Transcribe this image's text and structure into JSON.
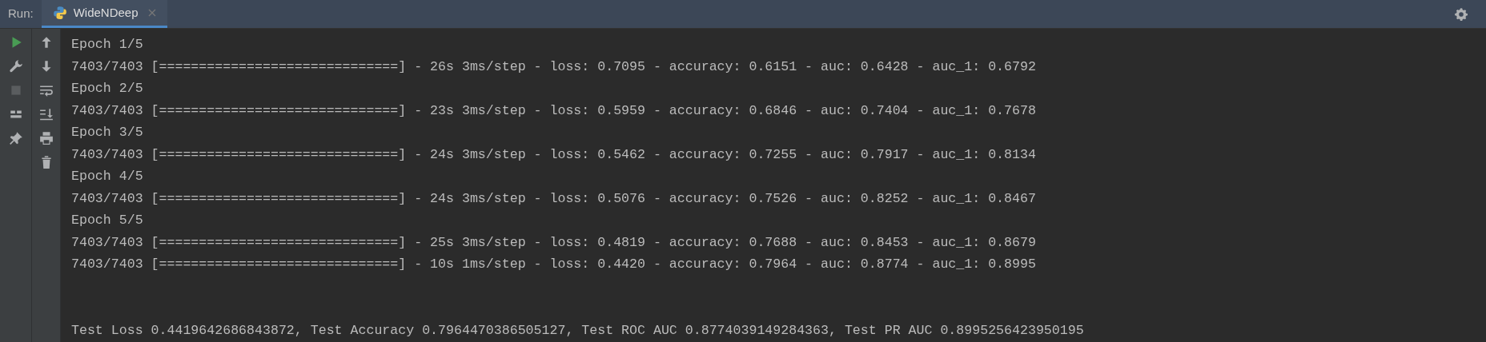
{
  "run_panel": {
    "label": "Run:",
    "tabs": [
      {
        "label": "WideNDeep",
        "selected": true
      }
    ]
  },
  "console": {
    "lines": [
      "Epoch 1/5",
      "7403/7403 [==============================] - 26s 3ms/step - loss: 0.7095 - accuracy: 0.6151 - auc: 0.6428 - auc_1: 0.6792",
      "Epoch 2/5",
      "7403/7403 [==============================] - 23s 3ms/step - loss: 0.5959 - accuracy: 0.6846 - auc: 0.7404 - auc_1: 0.7678",
      "Epoch 3/5",
      "7403/7403 [==============================] - 24s 3ms/step - loss: 0.5462 - accuracy: 0.7255 - auc: 0.7917 - auc_1: 0.8134",
      "Epoch 4/5",
      "7403/7403 [==============================] - 24s 3ms/step - loss: 0.5076 - accuracy: 0.7526 - auc: 0.8252 - auc_1: 0.8467",
      "Epoch 5/5",
      "7403/7403 [==============================] - 25s 3ms/step - loss: 0.4819 - accuracy: 0.7688 - auc: 0.8453 - auc_1: 0.8679",
      "7403/7403 [==============================] - 10s 1ms/step - loss: 0.4420 - accuracy: 0.7964 - auc: 0.8774 - auc_1: 0.8995"
    ],
    "result": "Test Loss 0.4419642686843872, Test Accuracy 0.7964470386505127, Test ROC AUC 0.8774039149284363, Test PR AUC 0.8995256423950195"
  }
}
